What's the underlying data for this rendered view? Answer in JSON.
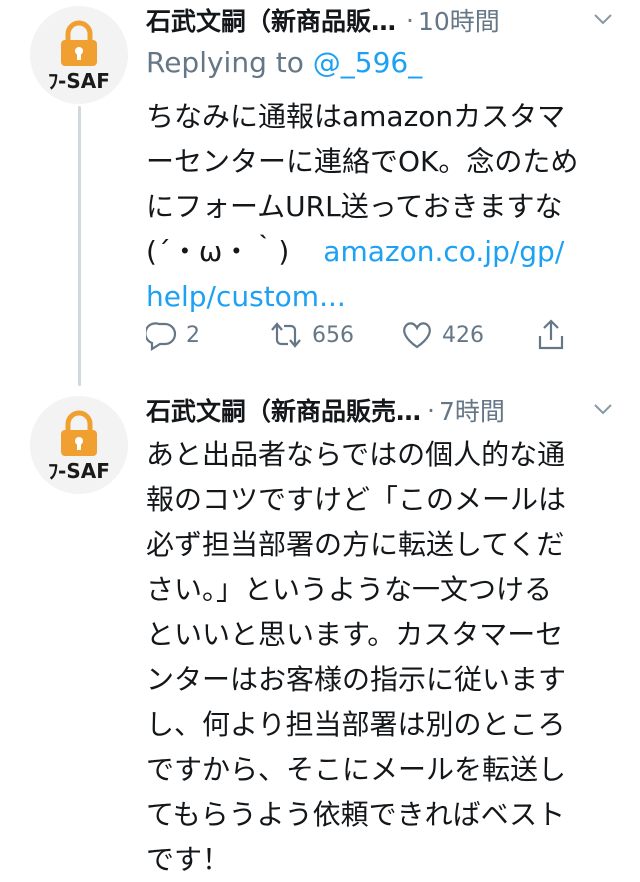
{
  "tweets": [
    {
      "author_name": "石武文嗣（新商品販…",
      "time": "10時間",
      "reply_prefix": "Replying to",
      "reply_handle": "@_596_",
      "lines": [
        "ちなみに通報はamazonカスタマ",
        "ーセンターに連絡でOK。念のため",
        "にフォームURL送っておきますな",
        "(´・ω・｀)"
      ],
      "link_part1": "amazon.co.jp/gp/",
      "link_part2": "help/custom...",
      "reply_count": "2",
      "retweet_count": "656",
      "like_count": "426"
    },
    {
      "author_name": "石武文嗣（新商品販売…",
      "time": "7時間",
      "lines": [
        "あと出品者ならではの個人的な通",
        "報のコツですけど「このメールは",
        "必ず担当部署の方に転送してくだ",
        "さい。」というような一文つける",
        "といいと思います。カスタマーセ",
        "ンターはお客様の指示に従います",
        "し、何より担当部署は別のところ",
        "ですから、そこにメールを転送し",
        "てもらうよう依頼できればベスト",
        "です！"
      ]
    }
  ],
  "avatar": {
    "logo_text": "ﾌ-SAF",
    "lock_color": "#f0a030",
    "text_color": "#1a1a1a"
  },
  "colors": {
    "link": "#1da1f2",
    "muted": "#657786",
    "thread_line": "#cfd9de"
  }
}
